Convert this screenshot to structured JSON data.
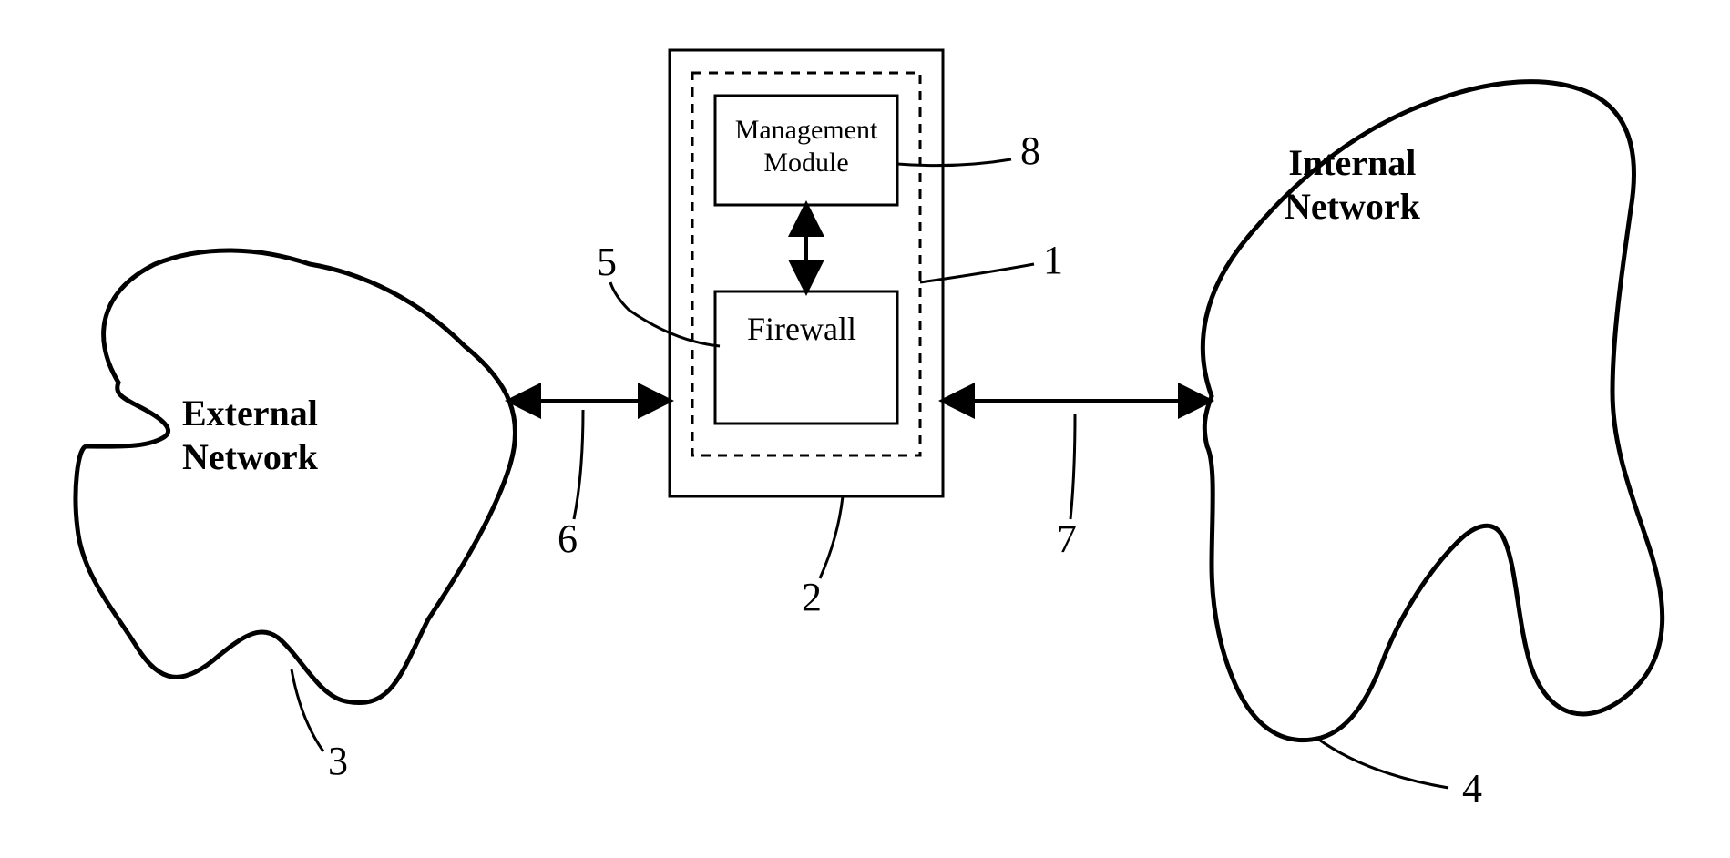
{
  "diagram": {
    "external_network": {
      "label_line1": "External",
      "label_line2": "Network"
    },
    "internal_network": {
      "label_line1": "Internal",
      "label_line2": "Network"
    },
    "gateway_box": {
      "management_module": {
        "label_line1": "Management",
        "label_line2": "Module"
      },
      "firewall": {
        "label": "Firewall"
      }
    },
    "reference_numbers": {
      "ref1": "1",
      "ref2": "2",
      "ref3": "3",
      "ref4": "4",
      "ref5": "5",
      "ref6": "6",
      "ref7": "7",
      "ref8": "8"
    }
  }
}
